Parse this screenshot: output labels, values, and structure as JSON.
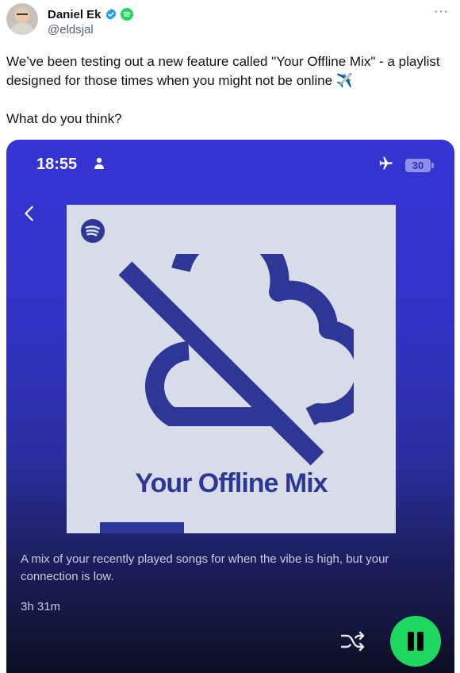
{
  "author": {
    "display_name": "Daniel Ek",
    "handle": "@eldsjal"
  },
  "tweet": {
    "text": "We’ve been testing out a new feature called \"Your Offline Mix\" - a playlist designed for those times when you might not be online ✈️\n\nWhat do you think?"
  },
  "more_label": "···",
  "phone": {
    "status_time": "18:55",
    "battery": "30",
    "cover_title": "Your Offline Mix",
    "description": "A mix of your recently played songs for when the vibe is high, but your connection is low.",
    "duration": "3h 31m"
  },
  "colors": {
    "spotify_green": "#1ed760",
    "verified_blue": "#1d9bf0",
    "cover_bg": "#d7dce8",
    "cover_ink": "#2f3796"
  },
  "icons": {
    "verified": "verified-badge-icon",
    "spotify": "spotify-icon",
    "plane": "airplane-icon",
    "back": "chevron-left-icon",
    "shuffle": "shuffle-icon",
    "pause": "pause-icon",
    "cloud_off": "cloud-off-icon"
  }
}
